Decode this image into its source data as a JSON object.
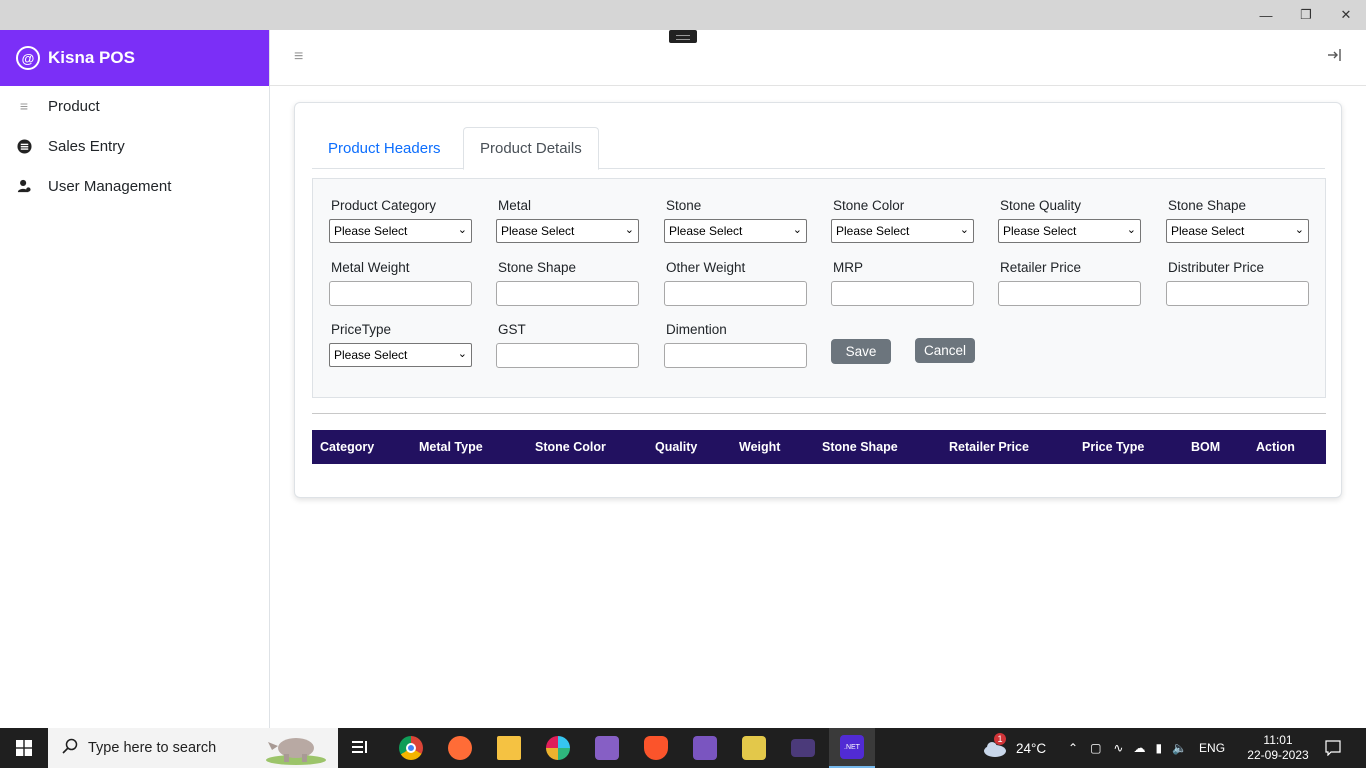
{
  "window": {
    "minimize_icon": "minimize-icon",
    "restore_icon": "restore-icon",
    "close_icon": "close-icon"
  },
  "brand": {
    "name": "Kisna POS"
  },
  "sidebar": {
    "items": [
      {
        "label": "Product",
        "icon": "list-icon"
      },
      {
        "label": "Sales Entry",
        "icon": "receipt-icon"
      },
      {
        "label": "User Management",
        "icon": "user-icon"
      }
    ]
  },
  "tabs": [
    {
      "label": "Product Headers",
      "active": false
    },
    {
      "label": "Product Details",
      "active": true
    }
  ],
  "form": {
    "fields": [
      {
        "label": "Product Category",
        "type": "select",
        "value": "Please Select"
      },
      {
        "label": "Metal",
        "type": "select",
        "value": "Please Select"
      },
      {
        "label": "Stone",
        "type": "select",
        "value": "Please Select"
      },
      {
        "label": "Stone Color",
        "type": "select",
        "value": "Please Select"
      },
      {
        "label": "Stone Quality",
        "type": "select",
        "value": "Please Select"
      },
      {
        "label": "Stone Shape",
        "type": "select",
        "value": "Please Select"
      },
      {
        "label": "Metal Weight",
        "type": "input",
        "value": ""
      },
      {
        "label": "Stone Shape",
        "type": "input",
        "value": ""
      },
      {
        "label": "Other Weight",
        "type": "input",
        "value": ""
      },
      {
        "label": "MRP",
        "type": "input",
        "value": ""
      },
      {
        "label": "Retailer Price",
        "type": "input",
        "value": ""
      },
      {
        "label": "Distributer Price",
        "type": "input",
        "value": ""
      },
      {
        "label": "PriceType",
        "type": "select",
        "value": "Please Select"
      },
      {
        "label": "GST",
        "type": "input",
        "value": ""
      },
      {
        "label": "Dimention",
        "type": "input",
        "value": ""
      }
    ],
    "save_label": "Save",
    "cancel_label": "Cancel"
  },
  "table": {
    "headers": [
      "Category",
      "Metal Type",
      "Stone Color",
      "Quality",
      "Weight",
      "Stone Shape",
      "Retailer Price",
      "Price Type",
      "BOM",
      "Action"
    ],
    "rows": []
  },
  "taskbar": {
    "search_placeholder": "Type here to search",
    "weather": "24°C",
    "weather_badge": "1",
    "language": "ENG",
    "time": "11:01",
    "date": "22-09-2023",
    "apps": [
      "task-view",
      "chrome",
      "postman",
      "file-explorer",
      "slack",
      "visual-studio",
      "brave",
      "visual-studio-2",
      "sticky-app",
      "terminal",
      "dotnet"
    ]
  },
  "colors": {
    "brand": "#7b2ff7",
    "table_header": "#221160",
    "link": "#0d6efd",
    "button": "#6c757d"
  }
}
